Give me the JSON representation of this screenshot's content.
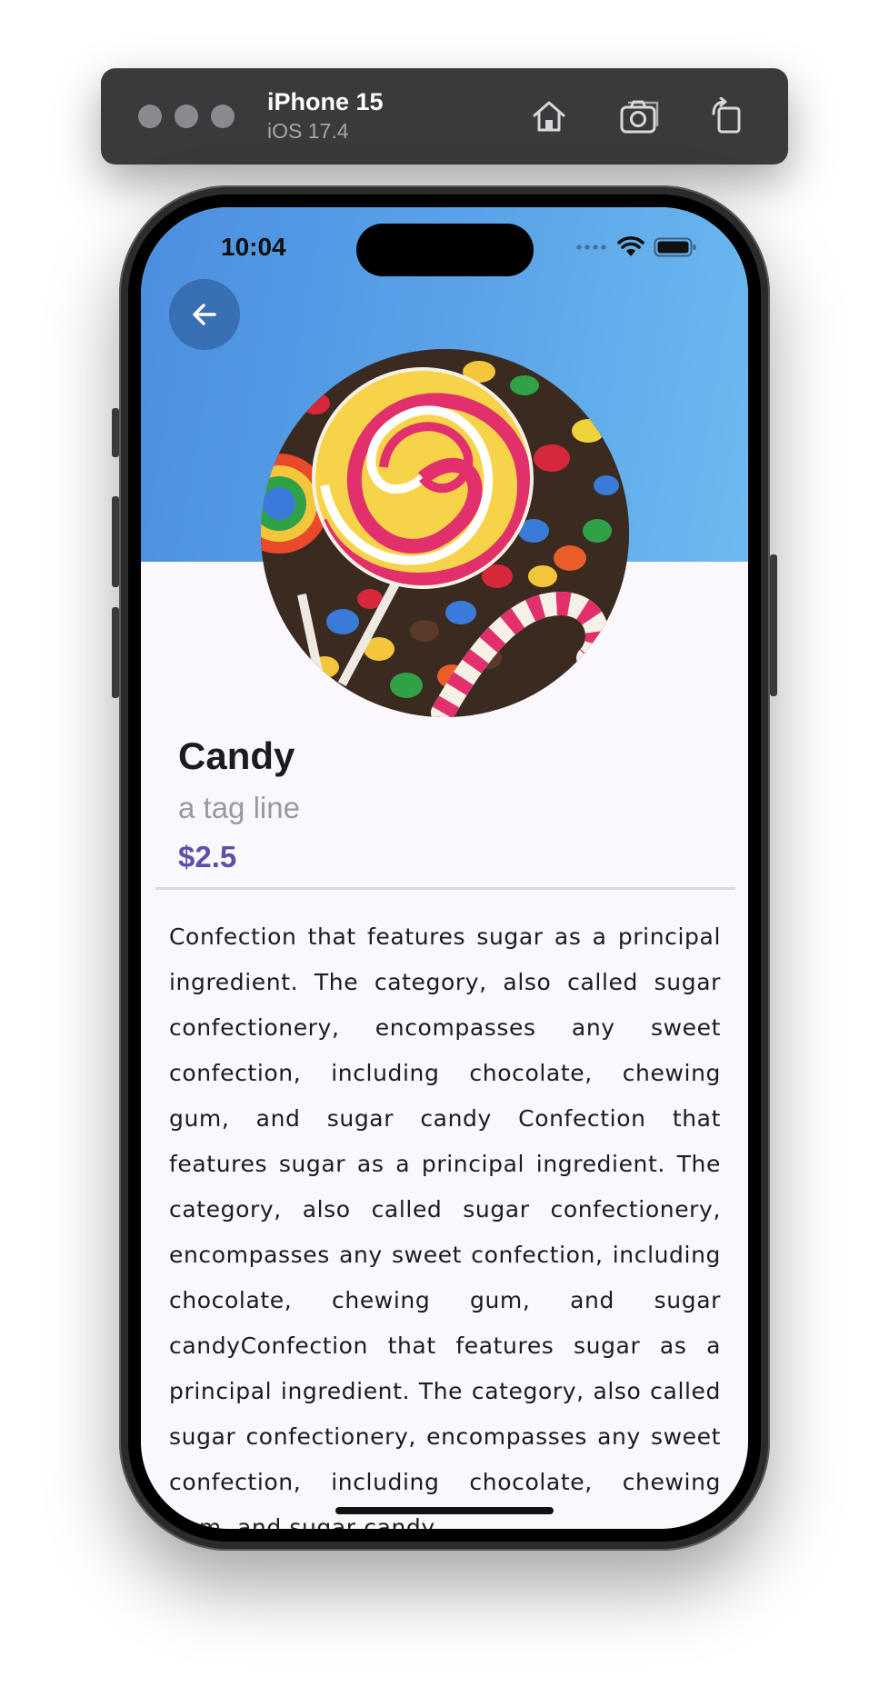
{
  "simulator": {
    "device_name": "iPhone 15",
    "os_version": "iOS 17.4",
    "icons": [
      "home-icon",
      "screenshot-icon",
      "rotate-icon"
    ]
  },
  "status_bar": {
    "time": "10:04",
    "icons": [
      "signal-dots-icon",
      "wifi-icon",
      "battery-icon"
    ]
  },
  "header": {
    "back_icon": "arrow-left-icon",
    "gradient_colors": [
      "#4a8fe0",
      "#6cbaf0"
    ]
  },
  "product": {
    "image": "candy-photo",
    "name": "Candy",
    "tagline": "a tag line",
    "price": "$2.5",
    "description": "Confection that features sugar as a principal ingredient. The category, also called sugar confectionery, encompasses any sweet confection, including chocolate, chewing gum, and sugar candy Confection that features sugar as a principal ingredient. The category, also called sugar confectionery, encompasses any sweet confection, including chocolate, chewing gum, and sugar candyConfection that features sugar as a principal ingredient. The category, also called sugar confectionery, encompasses any sweet confection, including chocolate, chewing gum, and sugar candy"
  },
  "colors": {
    "price": "#5b52a8",
    "tagline": "#9a98a0",
    "background": "#fbf8fd"
  }
}
